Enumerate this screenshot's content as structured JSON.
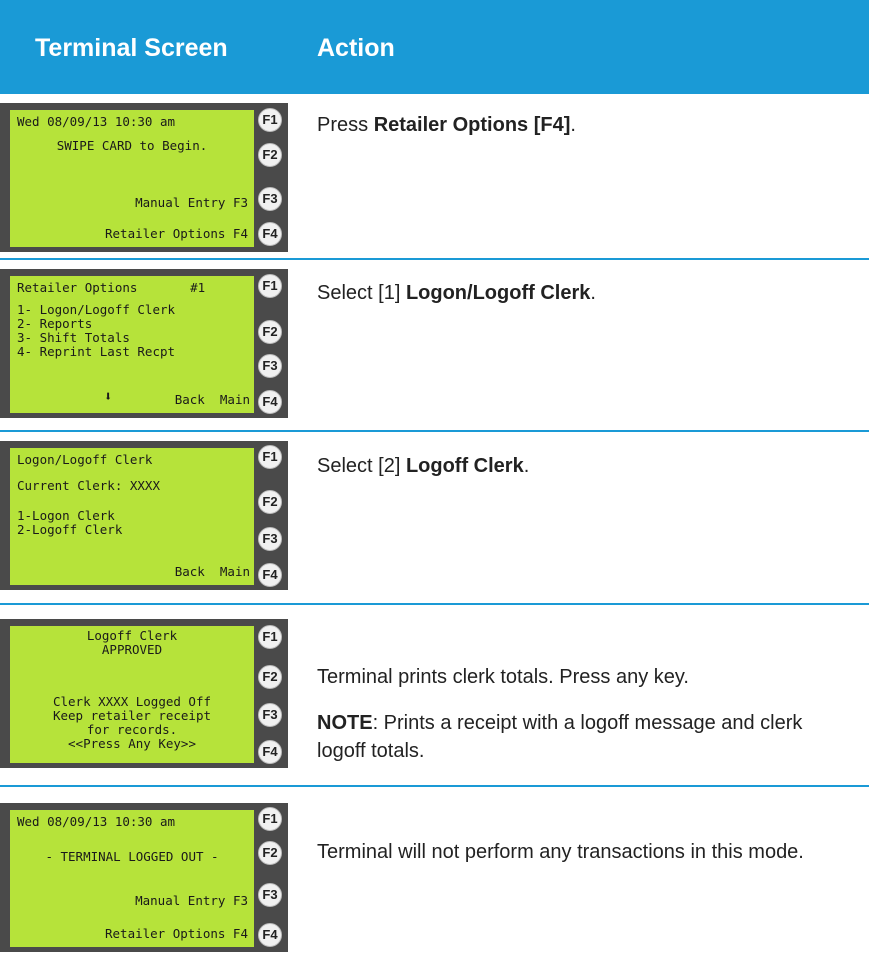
{
  "header": {
    "col1": "Terminal Screen",
    "col2": "Action"
  },
  "rows": [
    {
      "lcd": [
        {
          "text": "Wed 08/09/13 10:30 am",
          "align": "left"
        },
        {
          "text": "SWIPE CARD to Begin.",
          "align": "center"
        },
        {
          "text": "Manual Entry F3",
          "align": "right"
        },
        {
          "text": "Retailer Options F4",
          "align": "right"
        }
      ],
      "keys": [
        "F1",
        "F2",
        "F3",
        "F4"
      ],
      "action": {
        "pre": "Press ",
        "bold": "Retailer Options [F4]",
        "post": "."
      }
    },
    {
      "lcd": [
        {
          "text": "Retailer Options       #1",
          "align": "left"
        },
        {
          "text": "1- Logon/Logoff Clerk",
          "align": "left"
        },
        {
          "text": "2- Reports",
          "align": "left"
        },
        {
          "text": "3- Shift Totals",
          "align": "left"
        },
        {
          "text": "4- Reprint Last Recpt",
          "align": "left"
        },
        {
          "text": "Back  Main",
          "align": "right"
        }
      ],
      "arrow": "⬇",
      "keys": [
        "F1",
        "F2",
        "F3",
        "F4"
      ],
      "action": {
        "pre": "Select [1] ",
        "bold": "Logon/Logoff Clerk",
        "post": "."
      }
    },
    {
      "lcd": [
        {
          "text": "Logon/Logoff Clerk",
          "align": "left"
        },
        {
          "text": "Current Clerk: XXXX",
          "align": "left"
        },
        {
          "text": "1-Logon Clerk",
          "align": "left"
        },
        {
          "text": "2-Logoff Clerk",
          "align": "left"
        },
        {
          "text": "Back  Main",
          "align": "right"
        }
      ],
      "keys": [
        "F1",
        "F2",
        "F3",
        "F4"
      ],
      "action": {
        "pre": "Select [2] ",
        "bold": "Logoff Clerk",
        "post": "."
      }
    },
    {
      "lcd": [
        {
          "text": "Logoff Clerk",
          "align": "center"
        },
        {
          "text": "APPROVED",
          "align": "center"
        },
        {
          "text": "Clerk XXXX Logged Off",
          "align": "center"
        },
        {
          "text": "Keep retailer receipt",
          "align": "center"
        },
        {
          "text": "for records.",
          "align": "center"
        },
        {
          "text": "<<Press Any Key>>",
          "align": "center"
        }
      ],
      "keys": [
        "F1",
        "F2",
        "F3",
        "F4"
      ],
      "action": {
        "pre": "Terminal prints clerk totals. Press any key.",
        "bold": "",
        "post": ""
      },
      "note": {
        "label": "NOTE",
        "text": ": Prints a receipt with a logoff message and clerk logoff totals."
      }
    },
    {
      "lcd": [
        {
          "text": "Wed 08/09/13 10:30 am",
          "align": "left"
        },
        {
          "text": "- TERMINAL LOGGED OUT -",
          "align": "center"
        },
        {
          "text": "Manual Entry F3",
          "align": "right"
        },
        {
          "text": "Retailer Options F4",
          "align": "right"
        }
      ],
      "keys": [
        "F1",
        "F2",
        "F3",
        "F4"
      ],
      "action": {
        "pre": "Terminal will not perform any transactions in this mode.",
        "bold": "",
        "post": ""
      }
    }
  ]
}
